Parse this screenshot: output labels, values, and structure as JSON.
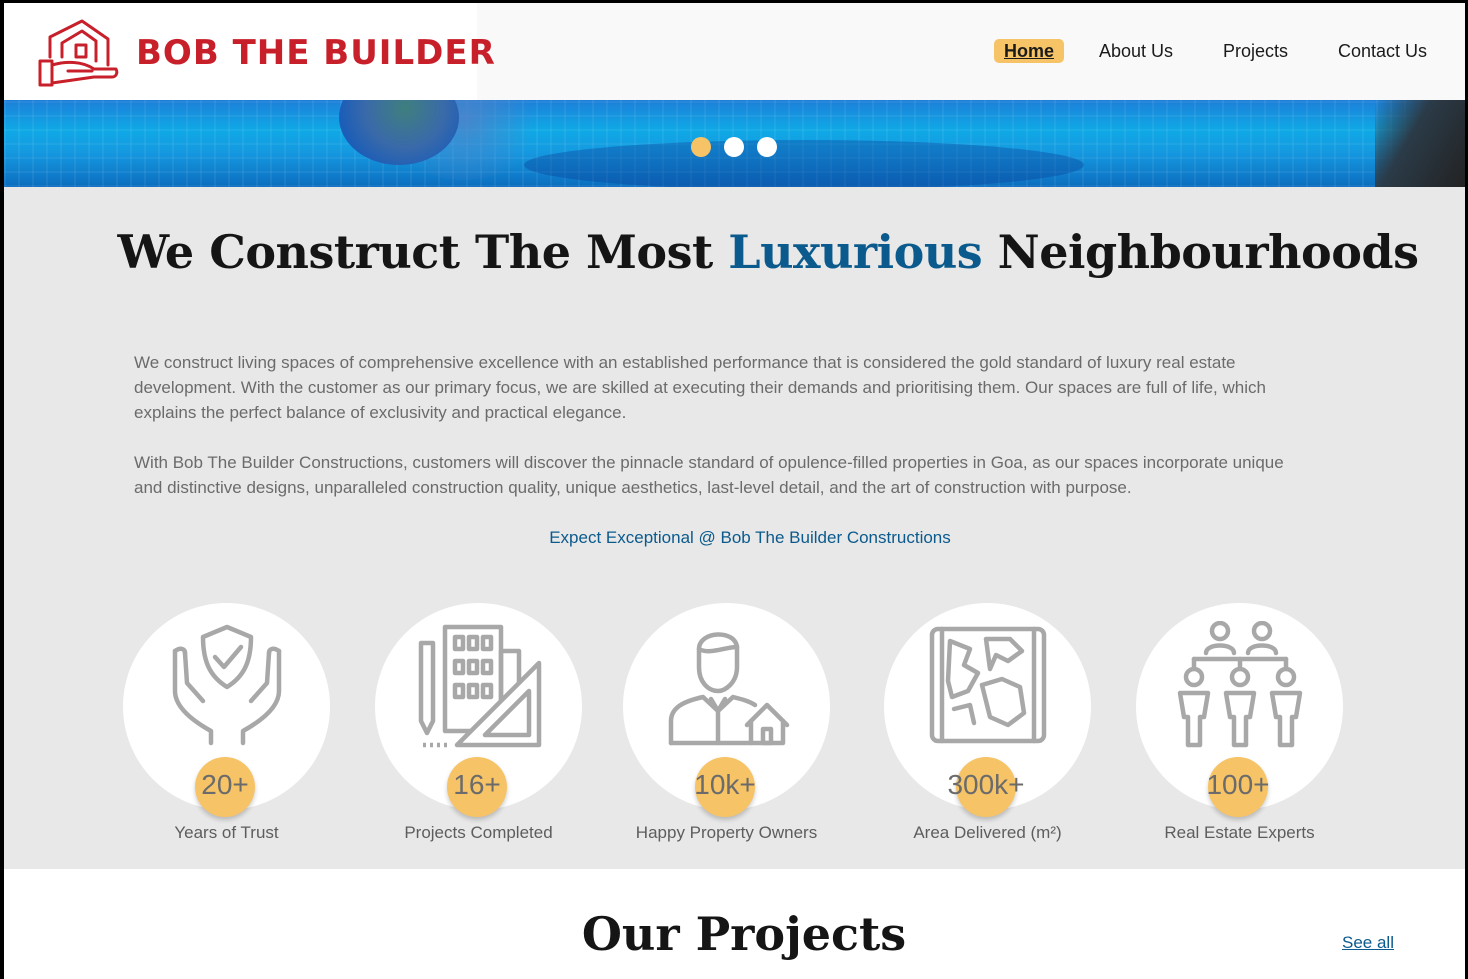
{
  "brand": {
    "name": "BOB THE BUILDER",
    "color": "#c8202a"
  },
  "nav": {
    "items": [
      {
        "label": "Home",
        "active": true
      },
      {
        "label": "About Us",
        "active": false
      },
      {
        "label": "Projects",
        "active": false
      },
      {
        "label": "Contact Us",
        "active": false
      }
    ]
  },
  "hero": {
    "slides": 3,
    "active_slide": 1
  },
  "about": {
    "headline_before": "We Construct The Most",
    "headline_accent": "Luxurious",
    "headline_after": "Neighbourhoods",
    "paragraph_1": "We construct living spaces of comprehensive excellence with an established performance that is considered the gold standard of luxury real estate development. With the customer as our primary focus, we are skilled at executing their demands and prioritising them. Our spaces are full of life, which explains the perfect balance of exclusivity and practical elegance.",
    "paragraph_2": "With Bob The Builder Constructions, customers will discover the pinnacle standard of opulence-filled properties in Goa, as our spaces incorporate unique and distinctive designs, unparalleled construction quality, unique aesthetics, last-level detail, and the art of construction with purpose.",
    "tagline": "Expect Exceptional @ Bob The Builder Constructions"
  },
  "stats": [
    {
      "value": "20+",
      "label": "Years of Trust",
      "icon": "hands-shield-icon"
    },
    {
      "value": "16+",
      "label": "Projects Completed",
      "icon": "buildings-blueprint-icon"
    },
    {
      "value": "10k+",
      "label": "Happy Property Owners",
      "icon": "owner-house-icon"
    },
    {
      "value": "300k+",
      "label": "Area Delivered (m²)",
      "icon": "map-icon"
    },
    {
      "value": "100+",
      "label": "Real Estate Experts",
      "icon": "team-icon"
    }
  ],
  "projects": {
    "title": "Our Projects",
    "see_all": "See all"
  },
  "colors": {
    "accent_yellow": "#f6c366",
    "accent_blue": "#0b5a8d",
    "section_grey": "#e8e8e8",
    "icon_grey": "#a8a8a8"
  }
}
